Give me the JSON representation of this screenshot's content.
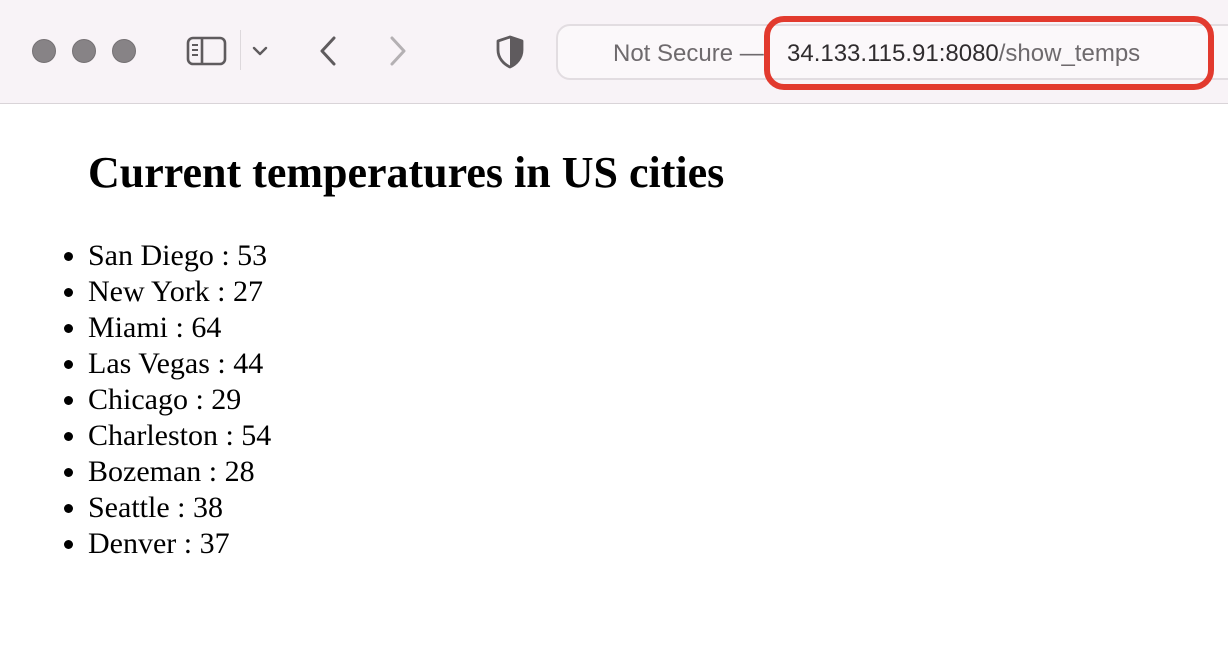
{
  "browser": {
    "address_bar": {
      "security_label": "Not Secure —",
      "host": "34.133.115.91:8080",
      "path": "/show_temps"
    },
    "icons": [
      "sidebar-icon",
      "chevron-down-icon",
      "back-arrow-icon",
      "forward-arrow-icon",
      "shield-icon"
    ],
    "highlight_color": "#e23a2e"
  },
  "page": {
    "heading": "Current temperatures in US cities",
    "cities": [
      {
        "text": "San Diego : 53"
      },
      {
        "text": "New York : 27"
      },
      {
        "text": "Miami : 64"
      },
      {
        "text": "Las Vegas : 44"
      },
      {
        "text": "Chicago : 29"
      },
      {
        "text": "Charleston : 54"
      },
      {
        "text": "Bozeman : 28"
      },
      {
        "text": "Seattle : 38"
      },
      {
        "text": "Denver : 37"
      }
    ]
  }
}
